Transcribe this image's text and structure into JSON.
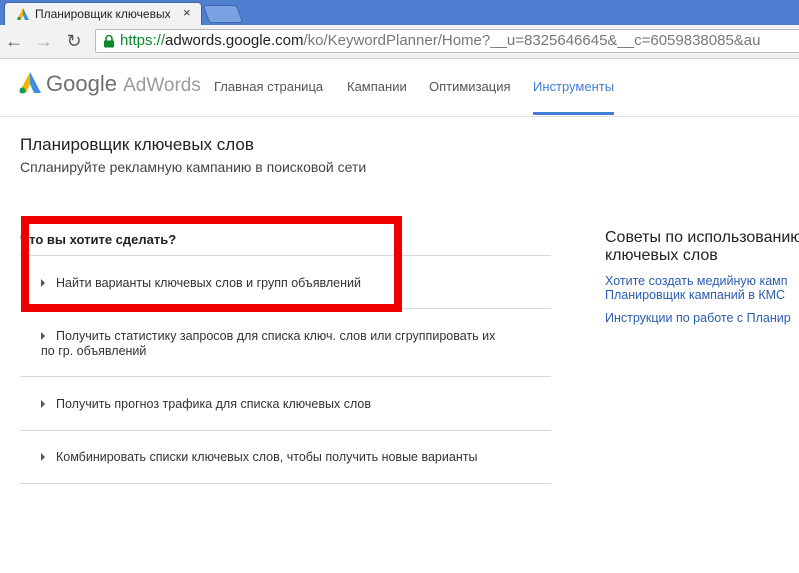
{
  "browser": {
    "tab_title": "Планировщик ключевых",
    "tab_close": "×",
    "url_scheme": "https://",
    "url_host": "adwords.google.com",
    "url_path": "/ko/KeywordPlanner/Home?__u=8325646645&__c=6059838085&au"
  },
  "adwords": {
    "brand_google": "Google",
    "brand_adwords": "AdWords",
    "nav": [
      "Главная страница",
      "Кампании",
      "Оптимизация",
      "Инструменты"
    ],
    "accent_color": "#3f7dd9"
  },
  "page": {
    "title": "Планировщик ключевых слов",
    "subtitle": "Спланируйте рекламную кампанию в поисковой сети",
    "question": "Что вы хотите сделать?",
    "options": [
      {
        "label": "Найти варианты ключевых слов и групп объявлений"
      },
      {
        "label_line1": "Получить статистику запросов для списка ключ. слов или сгруппировать их",
        "label_line2": "по гр. объявлений"
      },
      {
        "label": "Получить прогноз трафика для списка ключевых слов"
      },
      {
        "label": "Комбинировать списки ключевых слов, чтобы получить новые варианты"
      }
    ]
  },
  "tips": {
    "title_line1": "Советы по использованию",
    "title_line2": "ключевых слов",
    "link1_line1": "Хотите создать медийную камп",
    "link1_line2": "Планировщик кампаний в КМС",
    "link2": "Инструкции по работе с Планир"
  },
  "annotation": {
    "color": "#ee0000"
  }
}
